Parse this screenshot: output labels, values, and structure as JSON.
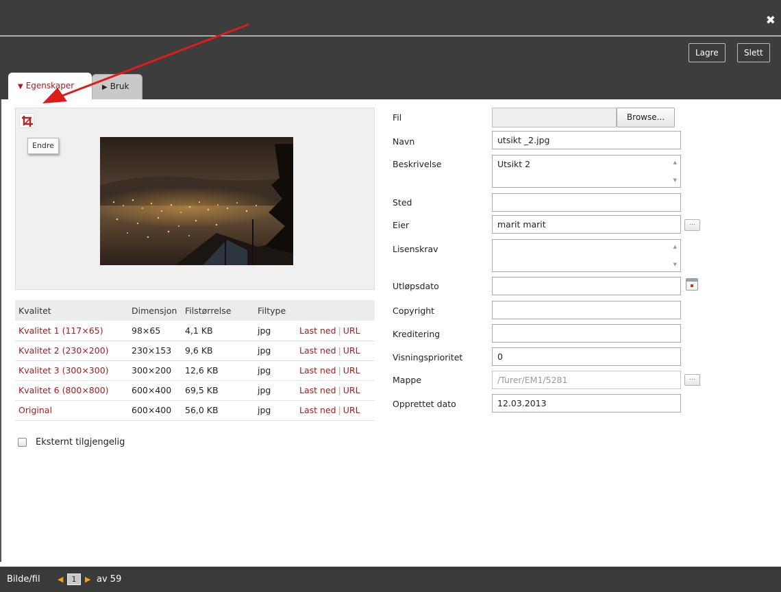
{
  "dialog": {
    "close_icon": "close-icon"
  },
  "toolbar": {
    "save_label": "Lagre",
    "delete_label": "Slett"
  },
  "tabs": [
    {
      "label": "Egenskaper",
      "active": true
    },
    {
      "label": "Bruk",
      "active": false
    }
  ],
  "preview": {
    "tooltip": "Endre",
    "crop_icon": "crop-icon"
  },
  "quality_table": {
    "headers": [
      "Kvalitet",
      "Dimensjon",
      "Filstørrelse",
      "Filtype"
    ],
    "rows": [
      {
        "quality": "Kvalitet 1 (117×65)",
        "dimension": "98×65",
        "size": "4,1 KB",
        "type": "jpg"
      },
      {
        "quality": "Kvalitet 2 (230×200)",
        "dimension": "230×153",
        "size": "9,6 KB",
        "type": "jpg"
      },
      {
        "quality": "Kvalitet 3 (300×300)",
        "dimension": "300×200",
        "size": "12,6 KB",
        "type": "jpg"
      },
      {
        "quality": "Kvalitet 6 (800×800)",
        "dimension": "600×400",
        "size": "69,5 KB",
        "type": "jpg"
      },
      {
        "quality": "Original",
        "dimension": "600×400",
        "size": "56,0 KB",
        "type": "jpg"
      }
    ],
    "download_label": "Last ned",
    "separator": "|",
    "url_label": "URL"
  },
  "external": {
    "label": "Eksternt tilgjengelig",
    "checked": false
  },
  "form": {
    "fil_label": "Fil",
    "browse_label": "Browse...",
    "navn_label": "Navn",
    "navn_value": "utsikt _2.jpg",
    "beskrivelse_label": "Beskrivelse",
    "beskrivelse_value": "Utsikt 2",
    "sted_label": "Sted",
    "sted_value": "",
    "eier_label": "Eier",
    "eier_value": "marit marit",
    "lisenskrav_label": "Lisenskrav",
    "lisenskrav_value": "",
    "utlopsdato_label": "Utløpsdato",
    "utlopsdato_value": "",
    "copyright_label": "Copyright",
    "copyright_value": "",
    "kreditering_label": "Kreditering",
    "kreditering_value": "",
    "visningsprioritet_label": "Visningsprioritet",
    "visningsprioritet_value": "0",
    "mappe_label": "Mappe",
    "mappe_value": "/Turer/EM1/5281",
    "opprettet_label": "Opprettet dato",
    "opprettet_value": "12.03.2013",
    "ellipsis": "..."
  },
  "footer": {
    "label": "Bilde/fil",
    "page": "1",
    "total": "av 59"
  },
  "colors": {
    "accent": "#a31c1c",
    "dark_bg": "#3d3d3d",
    "annotation_arrow": "#e01b1b"
  }
}
